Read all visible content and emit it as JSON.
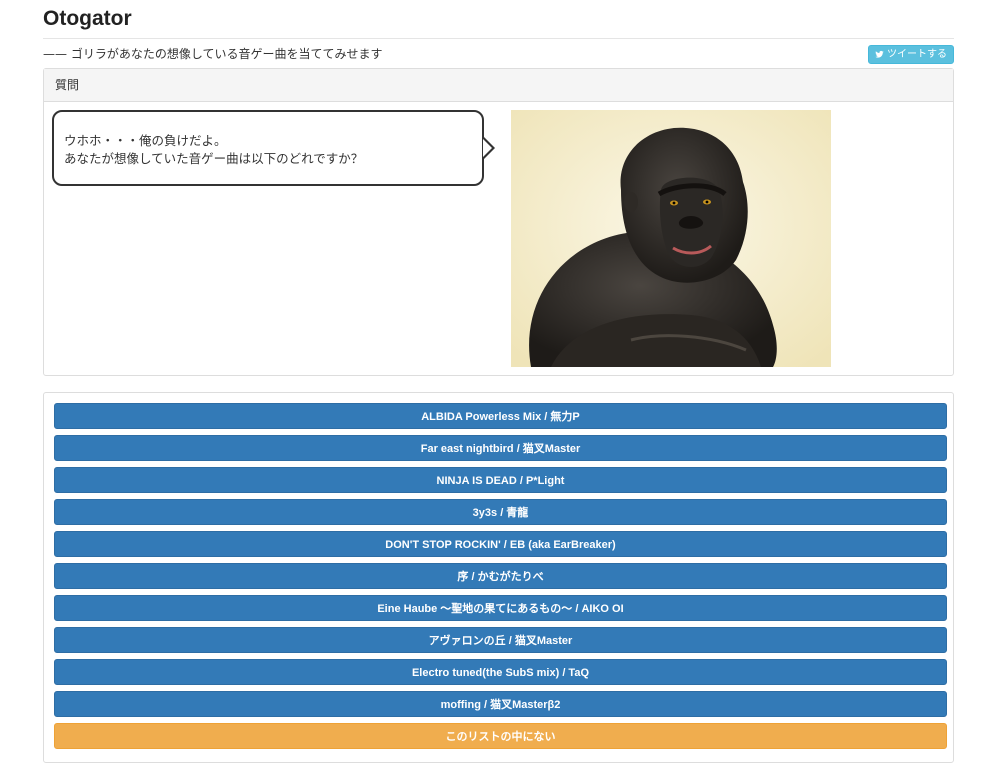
{
  "header": {
    "title": "Otogator",
    "subtitle": "—— ゴリラがあなたの想像している音ゲー曲を当ててみせます",
    "tweet_label": "ツイートする"
  },
  "question_panel": {
    "heading": "質問",
    "bubble_line1": "ウホホ・・・俺の負けだよ。",
    "bubble_line2": "あなたが想像していた音ゲー曲は以下のどれですか？"
  },
  "answers": [
    "ALBIDA Powerless Mix / 無力P",
    "Far east nightbird / 猫叉Master",
    "NINJA IS DEAD / P*Light",
    "3y3s / 青龍",
    "DON'T STOP ROCKIN' / EB (aka EarBreaker)",
    "序 / かむがたりべ",
    "Eine Haube 〜聖地の果てにあるもの〜 / AIKO OI",
    "アヴァロンの丘 / 猫叉Master",
    "Electro tuned(the SubS mix) / TaQ",
    "moffing / 猫叉Masterβ2"
  ],
  "none_label": "このリストの中にない",
  "colors": {
    "primary": "#337ab7",
    "warning": "#f0ad4e",
    "info": "#5bc0de"
  }
}
